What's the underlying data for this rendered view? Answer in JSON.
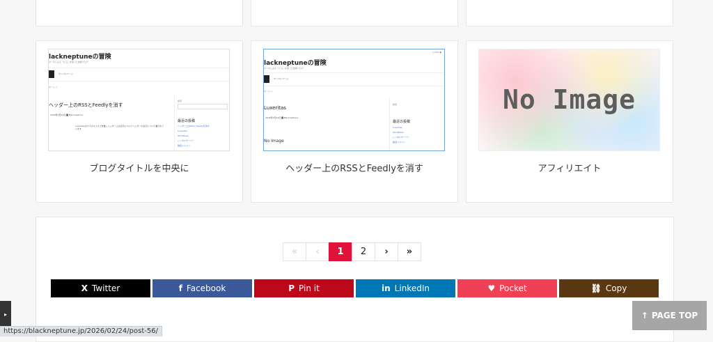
{
  "cards_top_row": [
    {
      "name": "card-top-1"
    },
    {
      "name": "card-top-2"
    },
    {
      "name": "card-top-3"
    }
  ],
  "cards": [
    {
      "title": "ブログタイトルを中央に",
      "thumb": {
        "blog_title": "lackneptuneの冒険",
        "subtitle": "ターボとよる「たる」を使った技術ブログ",
        "nav_text": "サンプルページ",
        "crumb": "ホーム ＞",
        "post_title": "ヘッダー上のRSSとFeedlyを消す",
        "meta": "2026年2月24日  ▇ Blackneptune",
        "side_label": "検索",
        "side_heading": "最近の投稿",
        "side_links": [
          "ヘッダー上のRSSとFeedlyを消す",
          "Luxeritas",
          "WordPress",
          "レンタルサーバー",
          "独自ドメイン"
        ],
        "body": "Luxeritasのカスタマイズで作業しヘッダー上の表示についてヘッダーの表示について書かれています"
      }
    },
    {
      "title": "ヘッダー上のRSSとFeedlyを消す",
      "thumb": {
        "blog_title": "lackneptuneの冒険",
        "subtitle": "ターボとよる「たる」を使った技術ブログ",
        "nav_text": "サンプルページ",
        "crumb": "ホーム ＞",
        "post_title": "Luxeritas",
        "meta": "2026年2月24日  ▇ Blackneptune",
        "side_label": "検索",
        "side_heading": "最近の投稿",
        "side_links": [
          "Luxeritas",
          "WordPress",
          "レンタルサーバー",
          "独自ドメイン"
        ],
        "noimage": "No Image",
        "toolbar": "◎ RSS  ●"
      }
    },
    {
      "title": "アフィリエイト",
      "noimage": "No Image"
    }
  ],
  "pagination": {
    "first": "«",
    "prev": "‹",
    "pages": [
      "1",
      "2"
    ],
    "current": "1",
    "next": "›",
    "last": "»"
  },
  "share_buttons": [
    {
      "label": "Twitter",
      "icon": "X",
      "color": "#000000"
    },
    {
      "label": "Facebook",
      "icon": "f",
      "color": "#3b5998"
    },
    {
      "label": "Pin it",
      "icon": "P",
      "color": "#bd081c"
    },
    {
      "label": "LinkedIn",
      "icon": "in",
      "color": "#0077b5"
    },
    {
      "label": "Pocket",
      "icon": "♥",
      "color": "#ef4056"
    },
    {
      "label": "Copy",
      "icon": "⛓",
      "color": "#5a3811"
    }
  ],
  "page_top": {
    "icon": "↑",
    "label": "PAGE TOP"
  },
  "side_toggle_icon": "▸",
  "status_url": "https://blackneptune.jp/2026/02/24/post-56/"
}
